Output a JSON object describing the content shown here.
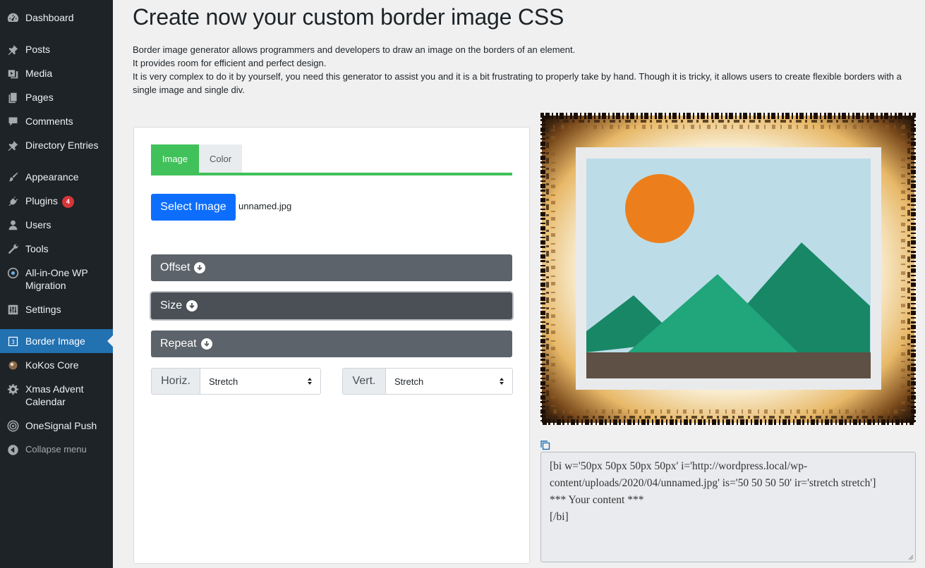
{
  "sidebar": {
    "items": [
      {
        "id": "dashboard",
        "label": "Dashboard",
        "icon": "dashboard-icon"
      },
      {
        "id": "posts",
        "label": "Posts",
        "icon": "pin-icon"
      },
      {
        "id": "media",
        "label": "Media",
        "icon": "media-icon"
      },
      {
        "id": "pages",
        "label": "Pages",
        "icon": "pages-icon"
      },
      {
        "id": "comments",
        "label": "Comments",
        "icon": "comment-icon"
      },
      {
        "id": "directory",
        "label": "Directory Entries",
        "icon": "pin-icon"
      },
      {
        "id": "appearance",
        "label": "Appearance",
        "icon": "brush-icon"
      },
      {
        "id": "plugins",
        "label": "Plugins",
        "icon": "plugin-icon",
        "badge": "4"
      },
      {
        "id": "users",
        "label": "Users",
        "icon": "user-icon"
      },
      {
        "id": "tools",
        "label": "Tools",
        "icon": "wrench-icon"
      },
      {
        "id": "migration",
        "label": "All-in-One WP Migration",
        "icon": "migration-icon"
      },
      {
        "id": "settings",
        "label": "Settings",
        "icon": "sliders-icon"
      },
      {
        "id": "border-image",
        "label": "Border Image",
        "icon": "border-image-icon",
        "current": true
      },
      {
        "id": "kokos",
        "label": "KoKos Core",
        "icon": "kokos-icon"
      },
      {
        "id": "xmas",
        "label": "Xmas Advent Calendar",
        "icon": "gear-icon"
      },
      {
        "id": "onesignal",
        "label": "OneSignal Push",
        "icon": "signal-icon"
      }
    ],
    "collapse_label": "Collapse menu"
  },
  "page": {
    "title": "Create now your custom border image CSS",
    "intro": [
      "Border image generator allows programmers and developers to draw an image on the borders of an element.",
      "It provides room for efficient and perfect design.",
      "It is very complex to do it by yourself, you need this generator to assist you and it is a bit frustrating to properly take by hand. Though it is tricky, it allows users to create flexible borders with a single image and single div."
    ]
  },
  "panel": {
    "tabs": [
      "Image",
      "Color"
    ],
    "active_tab": "Image",
    "select_image_label": "Select Image",
    "filename": "unnamed.jpg",
    "sections": [
      "Offset",
      "Size",
      "Repeat"
    ],
    "horizontal": {
      "label": "Horiz.",
      "value": "Stretch"
    },
    "vertical": {
      "label": "Vert.",
      "value": "Stretch"
    }
  },
  "output": {
    "code_lines": [
      "[bi w='50px 50px 50px 50px' i='http://wordpress.local/wp-",
      "content/uploads/2020/04/unnamed.jpg' is='50 50 50 50' ir='stretch stretch']",
      "*** Your content ***",
      "[/bi]"
    ]
  },
  "colors": {
    "sidebar_bg": "#1d2327",
    "sidebar_current": "#2271b1",
    "tab_active": "#40c15a",
    "select_button": "#0d6efd",
    "accordion": "#5c636a",
    "badge": "#d63638"
  }
}
